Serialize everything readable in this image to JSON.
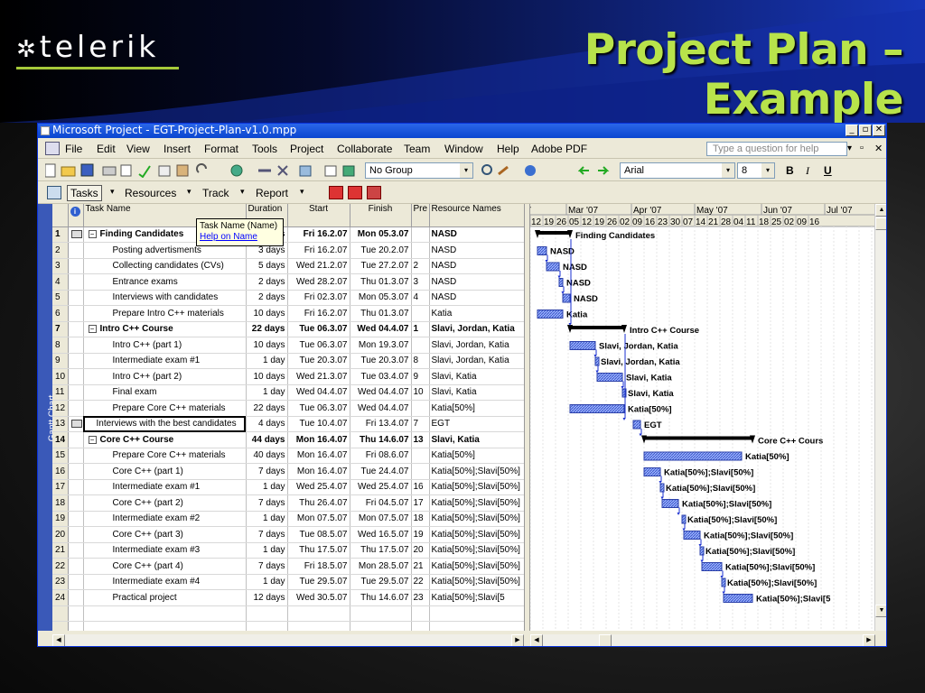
{
  "slide": {
    "logo": "telerik",
    "logo_mark": "✲",
    "title": "Project Plan – Example"
  },
  "window": {
    "title": "Microsoft Project - EGT-Project-Plan-v1.0.mpp",
    "min": "_",
    "restore": "▫",
    "close": "✕"
  },
  "menu": {
    "items": [
      "File",
      "Edit",
      "View",
      "Insert",
      "Format",
      "Tools",
      "Project",
      "Collaborate",
      "Team",
      "Window",
      "Help",
      "Adobe PDF"
    ],
    "help_placeholder": "Type a question for help",
    "help_dd": "▾",
    "doc_restore": "▫",
    "doc_close": "✕"
  },
  "toolbar": {
    "group": "No Group",
    "font": "Arial",
    "size": "8",
    "bold": "B",
    "italic": "I",
    "underline": "U",
    "dd": "▾"
  },
  "views": {
    "tasks": "Tasks",
    "resources": "Resources",
    "track": "Track",
    "report": "Report",
    "dd": "▾"
  },
  "colors": {
    "bar": "#5a78e0",
    "bar_hatch": "#9db4ff",
    "summary": "#000000"
  },
  "gantt_label": "Gantt Chart",
  "columns": {
    "id": "",
    "ind": "i",
    "name": "Task Name",
    "duration": "Duration",
    "start": "Start",
    "finish": "Finish",
    "pred": "Pre",
    "resources": "Resource Names"
  },
  "tooltip": {
    "title": "Task Name (Name)",
    "link": "Help on Name"
  },
  "tasks": [
    {
      "id": "1",
      "name": "Finding Candidates",
      "duration": "17 days",
      "start": "Fri 16.2.07",
      "finish": "Mon 05.3.07",
      "pred": "",
      "resources": "NASD",
      "summary": true,
      "ind": true
    },
    {
      "id": "2",
      "name": "Posting advertisments",
      "duration": "3 days",
      "start": "Fri 16.2.07",
      "finish": "Tue 20.2.07",
      "pred": "",
      "resources": "NASD"
    },
    {
      "id": "3",
      "name": "Collecting candidates (CVs)",
      "duration": "5 days",
      "start": "Wed 21.2.07",
      "finish": "Tue 27.2.07",
      "pred": "2",
      "resources": "NASD"
    },
    {
      "id": "4",
      "name": "Entrance exams",
      "duration": "2 days",
      "start": "Wed 28.2.07",
      "finish": "Thu 01.3.07",
      "pred": "3",
      "resources": "NASD"
    },
    {
      "id": "5",
      "name": "Interviews with candidates",
      "duration": "2 days",
      "start": "Fri 02.3.07",
      "finish": "Mon 05.3.07",
      "pred": "4",
      "resources": "NASD"
    },
    {
      "id": "6",
      "name": "Prepare Intro C++ materials",
      "duration": "10 days",
      "start": "Fri 16.2.07",
      "finish": "Thu 01.3.07",
      "pred": "",
      "resources": "Katia"
    },
    {
      "id": "7",
      "name": "Intro C++ Course",
      "duration": "22 days",
      "start": "Tue 06.3.07",
      "finish": "Wed 04.4.07",
      "pred": "1",
      "resources": "Slavi, Jordan, Katia",
      "summary": true
    },
    {
      "id": "8",
      "name": "Intro C++ (part 1)",
      "duration": "10 days",
      "start": "Tue 06.3.07",
      "finish": "Mon 19.3.07",
      "pred": "",
      "resources": "Slavi, Jordan, Katia"
    },
    {
      "id": "9",
      "name": "Intermediate exam #1",
      "duration": "1 day",
      "start": "Tue 20.3.07",
      "finish": "Tue 20.3.07",
      "pred": "8",
      "resources": "Slavi, Jordan, Katia"
    },
    {
      "id": "10",
      "name": "Intro C++ (part 2)",
      "duration": "10 days",
      "start": "Wed 21.3.07",
      "finish": "Tue 03.4.07",
      "pred": "9",
      "resources": "Slavi, Katia"
    },
    {
      "id": "11",
      "name": "Final exam",
      "duration": "1 day",
      "start": "Wed 04.4.07",
      "finish": "Wed 04.4.07",
      "pred": "10",
      "resources": "Slavi, Katia"
    },
    {
      "id": "12",
      "name": "Prepare Core C++ materials",
      "duration": "22 days",
      "start": "Tue 06.3.07",
      "finish": "Wed 04.4.07",
      "pred": "",
      "resources": "Katia[50%]"
    },
    {
      "id": "13",
      "name": "Interviews with the best candidates",
      "duration": "4 days",
      "start": "Tue 10.4.07",
      "finish": "Fri 13.4.07",
      "pred": "7",
      "resources": "EGT",
      "ind": true,
      "selected": true
    },
    {
      "id": "14",
      "name": "Core C++ Course",
      "duration": "44 days",
      "start": "Mon 16.4.07",
      "finish": "Thu 14.6.07",
      "pred": "13",
      "resources": "Slavi, Katia",
      "summary": true
    },
    {
      "id": "15",
      "name": "Prepare Core C++ materials",
      "duration": "40 days",
      "start": "Mon 16.4.07",
      "finish": "Fri 08.6.07",
      "pred": "",
      "resources": "Katia[50%]"
    },
    {
      "id": "16",
      "name": "Core C++ (part 1)",
      "duration": "7 days",
      "start": "Mon 16.4.07",
      "finish": "Tue 24.4.07",
      "pred": "",
      "resources": "Katia[50%];Slavi[50%]"
    },
    {
      "id": "17",
      "name": "Intermediate exam #1",
      "duration": "1 day",
      "start": "Wed 25.4.07",
      "finish": "Wed 25.4.07",
      "pred": "16",
      "resources": "Katia[50%];Slavi[50%]"
    },
    {
      "id": "18",
      "name": "Core C++ (part 2)",
      "duration": "7 days",
      "start": "Thu 26.4.07",
      "finish": "Fri 04.5.07",
      "pred": "17",
      "resources": "Katia[50%];Slavi[50%]"
    },
    {
      "id": "19",
      "name": "Intermediate exam #2",
      "duration": "1 day",
      "start": "Mon 07.5.07",
      "finish": "Mon 07.5.07",
      "pred": "18",
      "resources": "Katia[50%];Slavi[50%]"
    },
    {
      "id": "20",
      "name": "Core C++ (part 3)",
      "duration": "7 days",
      "start": "Tue 08.5.07",
      "finish": "Wed 16.5.07",
      "pred": "19",
      "resources": "Katia[50%];Slavi[50%]"
    },
    {
      "id": "21",
      "name": "Intermediate exam #3",
      "duration": "1 day",
      "start": "Thu 17.5.07",
      "finish": "Thu 17.5.07",
      "pred": "20",
      "resources": "Katia[50%];Slavi[50%]"
    },
    {
      "id": "22",
      "name": "Core C++ (part 4)",
      "duration": "7 days",
      "start": "Fri 18.5.07",
      "finish": "Mon 28.5.07",
      "pred": "21",
      "resources": "Katia[50%];Slavi[50%]"
    },
    {
      "id": "23",
      "name": "Intermediate exam #4",
      "duration": "1 day",
      "start": "Tue 29.5.07",
      "finish": "Tue 29.5.07",
      "pred": "22",
      "resources": "Katia[50%];Slavi[50%]"
    },
    {
      "id": "24",
      "name": "Practical project",
      "duration": "12 days",
      "start": "Wed 30.5.07",
      "finish": "Thu 14.6.07",
      "pred": "23",
      "resources": "Katia[50%];Slavi[5"
    }
  ],
  "timescale": {
    "months": [
      "07",
      "Mar '07",
      "Apr '07",
      "May '07",
      "Jun '07",
      "Jul '07"
    ],
    "weeks": [
      "12",
      "19",
      "26",
      "05",
      "12",
      "19",
      "26",
      "02",
      "09",
      "16",
      "23",
      "30",
      "07",
      "14",
      "21",
      "28",
      "04",
      "11",
      "18",
      "25",
      "02",
      "09",
      "16"
    ]
  },
  "gantt_bars": [
    {
      "row": 1,
      "start": "2007-02-16",
      "finish": "2007-03-05",
      "summary": true,
      "label": "Finding Candidates"
    },
    {
      "row": 2,
      "start": "2007-02-16",
      "finish": "2007-02-20",
      "label": "NASD"
    },
    {
      "row": 3,
      "start": "2007-02-21",
      "finish": "2007-02-27",
      "label": "NASD"
    },
    {
      "row": 4,
      "start": "2007-02-28",
      "finish": "2007-03-01",
      "label": "NASD"
    },
    {
      "row": 5,
      "start": "2007-03-02",
      "finish": "2007-03-05",
      "label": "NASD"
    },
    {
      "row": 6,
      "start": "2007-02-16",
      "finish": "2007-03-01",
      "label": "Katia"
    },
    {
      "row": 7,
      "start": "2007-03-06",
      "finish": "2007-04-04",
      "summary": true,
      "label": "Intro C++ Course"
    },
    {
      "row": 8,
      "start": "2007-03-06",
      "finish": "2007-03-19",
      "label": "Slavi, Jordan, Katia"
    },
    {
      "row": 9,
      "start": "2007-03-20",
      "finish": "2007-03-20",
      "label": "Slavi, Jordan, Katia"
    },
    {
      "row": 10,
      "start": "2007-03-21",
      "finish": "2007-04-03",
      "label": "Slavi, Katia"
    },
    {
      "row": 11,
      "start": "2007-04-04",
      "finish": "2007-04-04",
      "label": "Slavi, Katia"
    },
    {
      "row": 12,
      "start": "2007-03-06",
      "finish": "2007-04-04",
      "label": "Katia[50%]"
    },
    {
      "row": 13,
      "start": "2007-04-10",
      "finish": "2007-04-13",
      "label": "EGT"
    },
    {
      "row": 14,
      "start": "2007-04-16",
      "finish": "2007-06-14",
      "summary": true,
      "label": "Core C++ Cours"
    },
    {
      "row": 15,
      "start": "2007-04-16",
      "finish": "2007-06-08",
      "label": "Katia[50%]"
    },
    {
      "row": 16,
      "start": "2007-04-16",
      "finish": "2007-04-24",
      "label": "Katia[50%];Slavi[50%]"
    },
    {
      "row": 17,
      "start": "2007-04-25",
      "finish": "2007-04-25",
      "label": "Katia[50%];Slavi[50%]"
    },
    {
      "row": 18,
      "start": "2007-04-26",
      "finish": "2007-05-04",
      "label": "Katia[50%];Slavi[50%]"
    },
    {
      "row": 19,
      "start": "2007-05-07",
      "finish": "2007-05-07",
      "label": "Katia[50%];Slavi[50%]"
    },
    {
      "row": 20,
      "start": "2007-05-08",
      "finish": "2007-05-16",
      "label": "Katia[50%];Slavi[50%]"
    },
    {
      "row": 21,
      "start": "2007-05-17",
      "finish": "2007-05-17",
      "label": "Katia[50%];Slavi[50%]"
    },
    {
      "row": 22,
      "start": "2007-05-18",
      "finish": "2007-05-28",
      "label": "Katia[50%];Slavi[50%]"
    },
    {
      "row": 23,
      "start": "2007-05-29",
      "finish": "2007-05-29",
      "label": "Katia[50%];Slavi[50%]"
    },
    {
      "row": 24,
      "start": "2007-05-30",
      "finish": "2007-06-14",
      "label": "Katia[50%];Slavi[5"
    }
  ]
}
